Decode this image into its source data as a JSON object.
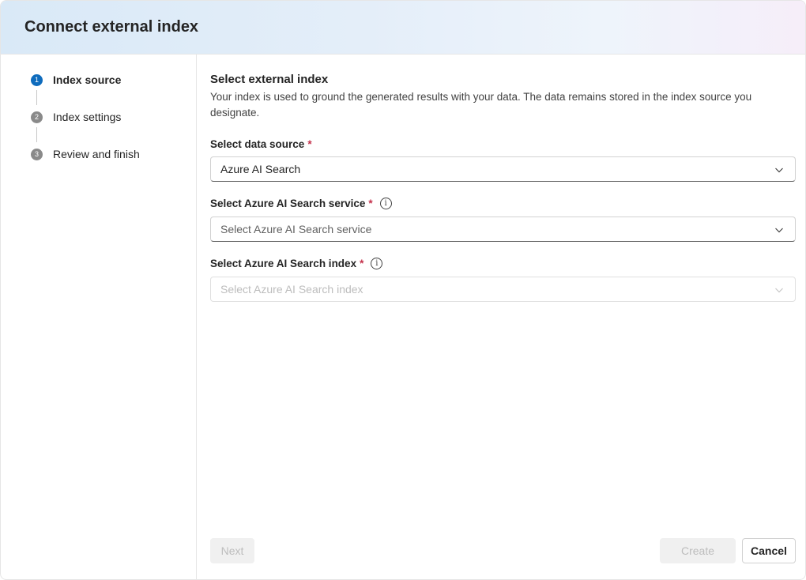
{
  "dialog": {
    "title": "Connect external index"
  },
  "steps": [
    {
      "number": "1",
      "label": "Index source",
      "active": true
    },
    {
      "number": "2",
      "label": "Index settings",
      "active": false
    },
    {
      "number": "3",
      "label": "Review and finish",
      "active": false
    }
  ],
  "main": {
    "heading": "Select external index",
    "description": "Your index is used to ground the generated results with your data. The data remains stored in the index source you designate.",
    "fields": {
      "data_source": {
        "label": "Select data source",
        "required_mark": "*",
        "value": "Azure AI Search"
      },
      "search_service": {
        "label": "Select Azure AI Search service",
        "required_mark": "*",
        "placeholder": "Select Azure AI Search service"
      },
      "search_index": {
        "label": "Select Azure AI Search index",
        "required_mark": "*",
        "placeholder": "Select Azure AI Search index"
      }
    }
  },
  "footer": {
    "next_label": "Next",
    "create_label": "Create",
    "cancel_label": "Cancel"
  },
  "icons": {
    "info": "info-icon",
    "chevron": "chevron-down-icon"
  },
  "colors": {
    "accent": "#0f6cbd",
    "required": "#c4314b"
  }
}
